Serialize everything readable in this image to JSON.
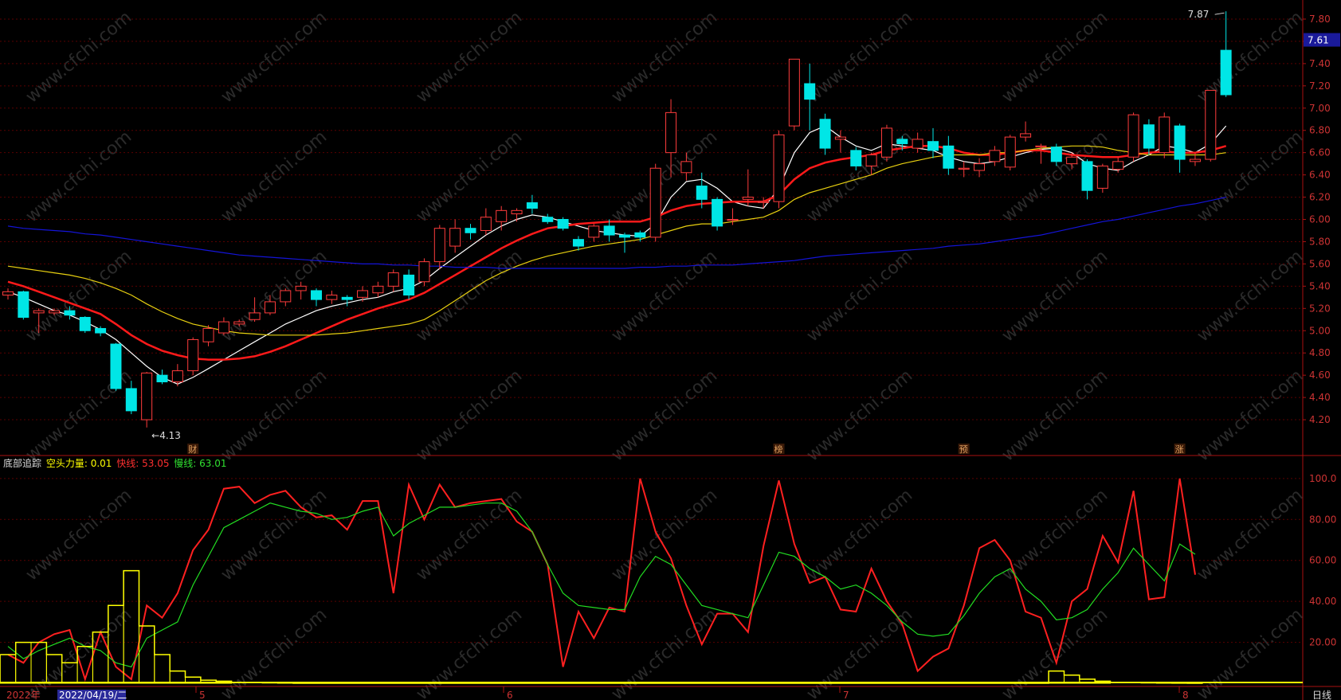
{
  "chart_data": [
    {
      "type": "candlestick",
      "ylim": [
        4.0,
        7.9
      ],
      "y_ticks": [
        "4.20",
        "4.40",
        "4.60",
        "4.80",
        "5.00",
        "5.20",
        "5.40",
        "5.60",
        "5.80",
        "6.00",
        "6.20",
        "6.40",
        "6.60",
        "6.80",
        "7.00",
        "7.20",
        "7.40",
        "7.60",
        "7.80"
      ],
      "current_price": "7.61",
      "high_label": "7.87",
      "low_label": "4.13",
      "markers": [
        "财",
        "榜",
        "预",
        "涨"
      ],
      "candles": [
        [
          5.32,
          5.35,
          5.28,
          5.38
        ],
        [
          5.35,
          5.12,
          5.1,
          5.36
        ],
        [
          5.16,
          5.18,
          4.98,
          5.2
        ],
        [
          5.16,
          5.18,
          5.14,
          5.2
        ],
        [
          5.18,
          5.14,
          5.1,
          5.22
        ],
        [
          5.12,
          5.0,
          4.98,
          5.13
        ],
        [
          5.02,
          4.98,
          4.95,
          5.04
        ],
        [
          4.88,
          4.48,
          4.46,
          4.89
        ],
        [
          4.48,
          4.28,
          4.25,
          4.55
        ],
        [
          4.2,
          4.62,
          4.13,
          4.63
        ],
        [
          4.6,
          4.54,
          4.52,
          4.65
        ],
        [
          4.54,
          4.64,
          4.5,
          4.7
        ],
        [
          4.64,
          4.92,
          4.6,
          4.94
        ],
        [
          4.9,
          5.02,
          4.86,
          5.05
        ],
        [
          4.98,
          5.08,
          4.96,
          5.12
        ],
        [
          5.06,
          5.08,
          5.04,
          5.1
        ],
        [
          5.1,
          5.16,
          5.08,
          5.3
        ],
        [
          5.16,
          5.26,
          5.14,
          5.32
        ],
        [
          5.26,
          5.36,
          5.22,
          5.38
        ],
        [
          5.36,
          5.4,
          5.28,
          5.44
        ],
        [
          5.36,
          5.28,
          5.22,
          5.38
        ],
        [
          5.28,
          5.32,
          5.24,
          5.36
        ],
        [
          5.3,
          5.28,
          5.22,
          5.32
        ],
        [
          5.3,
          5.36,
          5.26,
          5.4
        ],
        [
          5.34,
          5.4,
          5.3,
          5.44
        ],
        [
          5.4,
          5.52,
          5.35,
          5.55
        ],
        [
          5.5,
          5.32,
          5.28,
          5.55
        ],
        [
          5.44,
          5.62,
          5.4,
          5.65
        ],
        [
          5.62,
          5.92,
          5.55,
          5.95
        ],
        [
          5.76,
          5.92,
          5.7,
          6.0
        ],
        [
          5.92,
          5.88,
          5.82,
          5.96
        ],
        [
          5.9,
          6.02,
          5.86,
          6.1
        ],
        [
          5.98,
          6.08,
          5.9,
          6.12
        ],
        [
          6.05,
          6.08,
          5.98,
          6.1
        ],
        [
          6.15,
          6.1,
          6.05,
          6.22
        ],
        [
          6.02,
          5.98,
          5.96,
          6.05
        ],
        [
          6.0,
          5.92,
          5.9,
          6.02
        ],
        [
          5.82,
          5.76,
          5.72,
          5.85
        ],
        [
          5.84,
          5.94,
          5.8,
          5.96
        ],
        [
          5.94,
          5.86,
          5.8,
          6.0
        ],
        [
          5.86,
          5.84,
          5.7,
          5.88
        ],
        [
          5.88,
          5.84,
          5.8,
          5.9
        ],
        [
          5.84,
          6.46,
          5.8,
          6.5
        ],
        [
          6.6,
          6.96,
          6.38,
          7.08
        ],
        [
          6.42,
          6.52,
          6.35,
          6.6
        ],
        [
          6.3,
          6.18,
          6.1,
          6.42
        ],
        [
          6.18,
          5.94,
          5.9,
          6.2
        ],
        [
          6.0,
          6.0,
          5.95,
          6.1
        ],
        [
          6.18,
          6.2,
          6.12,
          6.45
        ],
        [
          6.16,
          6.16,
          6.1,
          6.2
        ],
        [
          6.16,
          6.76,
          6.1,
          6.8
        ],
        [
          6.84,
          7.44,
          6.8,
          7.44
        ],
        [
          7.22,
          7.08,
          6.8,
          7.4
        ],
        [
          6.9,
          6.64,
          6.58,
          6.95
        ],
        [
          6.72,
          6.74,
          6.6,
          6.8
        ],
        [
          6.62,
          6.48,
          6.44,
          6.65
        ],
        [
          6.48,
          6.58,
          6.4,
          6.6
        ],
        [
          6.56,
          6.82,
          6.52,
          6.85
        ],
        [
          6.72,
          6.68,
          6.62,
          6.75
        ],
        [
          6.64,
          6.72,
          6.6,
          6.78
        ],
        [
          6.7,
          6.62,
          6.55,
          6.82
        ],
        [
          6.66,
          6.46,
          6.4,
          6.75
        ],
        [
          6.46,
          6.46,
          6.38,
          6.52
        ],
        [
          6.44,
          6.5,
          6.38,
          6.55
        ],
        [
          6.52,
          6.62,
          6.48,
          6.66
        ],
        [
          6.47,
          6.74,
          6.44,
          6.76
        ],
        [
          6.74,
          6.77,
          6.7,
          6.88
        ],
        [
          6.66,
          6.66,
          6.5,
          6.68
        ],
        [
          6.65,
          6.52,
          6.48,
          6.68
        ],
        [
          6.5,
          6.56,
          6.45,
          6.6
        ],
        [
          6.52,
          6.26,
          6.18,
          6.54
        ],
        [
          6.28,
          6.48,
          6.24,
          6.5
        ],
        [
          6.45,
          6.52,
          6.42,
          6.56
        ],
        [
          6.56,
          6.94,
          6.52,
          6.96
        ],
        [
          6.85,
          6.64,
          6.58,
          6.9
        ],
        [
          6.6,
          6.92,
          6.55,
          6.96
        ],
        [
          6.84,
          6.54,
          6.42,
          6.86
        ],
        [
          6.52,
          6.54,
          6.48,
          6.6
        ],
        [
          6.54,
          7.16,
          6.52,
          7.16
        ],
        [
          7.52,
          7.12,
          7.1,
          7.87
        ]
      ],
      "ma_series": [
        {
          "color": "#ffffff",
          "values": [
            5.35,
            5.3,
            5.24,
            5.18,
            5.14,
            5.08,
            5.01,
            4.92,
            4.8,
            4.68,
            4.58,
            4.52,
            4.58,
            4.66,
            4.74,
            4.82,
            4.9,
            4.98,
            5.06,
            5.12,
            5.18,
            5.22,
            5.25,
            5.28,
            5.3,
            5.35,
            5.38,
            5.45,
            5.56,
            5.66,
            5.76,
            5.86,
            5.94,
            6.0,
            6.04,
            6.02,
            5.98,
            5.94,
            5.9,
            5.88,
            5.86,
            5.85,
            5.96,
            6.2,
            6.34,
            6.36,
            6.28,
            6.16,
            6.12,
            6.1,
            6.28,
            6.6,
            6.78,
            6.84,
            6.74,
            6.66,
            6.62,
            6.68,
            6.66,
            6.64,
            6.62,
            6.56,
            6.52,
            6.5,
            6.52,
            6.56,
            6.6,
            6.63,
            6.64,
            6.6,
            6.5,
            6.46,
            6.44,
            6.52,
            6.58,
            6.66,
            6.64,
            6.6,
            6.68,
            6.84
          ]
        },
        {
          "color": "#ff1a1a",
          "values": [
            5.44,
            5.4,
            5.35,
            5.3,
            5.25,
            5.2,
            5.15,
            5.06,
            4.96,
            4.88,
            4.82,
            4.78,
            4.75,
            4.74,
            4.74,
            4.75,
            4.77,
            4.81,
            4.86,
            4.92,
            4.98,
            5.04,
            5.1,
            5.15,
            5.2,
            5.24,
            5.28,
            5.34,
            5.42,
            5.5,
            5.58,
            5.66,
            5.74,
            5.81,
            5.87,
            5.92,
            5.94,
            5.96,
            5.97,
            5.98,
            5.98,
            5.98,
            6.02,
            6.08,
            6.12,
            6.14,
            6.15,
            6.16,
            6.16,
            6.16,
            6.22,
            6.36,
            6.46,
            6.51,
            6.54,
            6.56,
            6.58,
            6.62,
            6.64,
            6.66,
            6.66,
            6.64,
            6.6,
            6.58,
            6.58,
            6.6,
            6.62,
            6.62,
            6.6,
            6.58,
            6.57,
            6.56,
            6.56,
            6.58,
            6.6,
            6.61,
            6.6,
            6.6,
            6.62,
            6.66
          ]
        },
        {
          "color": "#e8d010",
          "values": [
            5.58,
            5.56,
            5.54,
            5.52,
            5.5,
            5.47,
            5.43,
            5.38,
            5.32,
            5.24,
            5.17,
            5.11,
            5.06,
            5.03,
            5.0,
            4.98,
            4.97,
            4.96,
            4.96,
            4.96,
            4.96,
            4.97,
            4.98,
            5.0,
            5.02,
            5.04,
            5.06,
            5.1,
            5.18,
            5.27,
            5.36,
            5.45,
            5.52,
            5.58,
            5.63,
            5.67,
            5.7,
            5.73,
            5.76,
            5.78,
            5.8,
            5.82,
            5.86,
            5.9,
            5.94,
            5.96,
            5.96,
            5.98,
            6.0,
            6.02,
            6.08,
            6.18,
            6.24,
            6.28,
            6.32,
            6.36,
            6.4,
            6.46,
            6.5,
            6.53,
            6.56,
            6.58,
            6.58,
            6.58,
            6.6,
            6.6,
            6.62,
            6.64,
            6.65,
            6.66,
            6.66,
            6.65,
            6.62,
            6.6,
            6.58,
            6.58,
            6.58,
            6.58,
            6.58,
            6.6
          ]
        },
        {
          "color": "#1414d8",
          "values": [
            5.94,
            5.92,
            5.91,
            5.9,
            5.89,
            5.87,
            5.86,
            5.84,
            5.82,
            5.8,
            5.78,
            5.76,
            5.74,
            5.72,
            5.7,
            5.68,
            5.67,
            5.66,
            5.65,
            5.64,
            5.63,
            5.62,
            5.61,
            5.6,
            5.6,
            5.59,
            5.59,
            5.58,
            5.58,
            5.57,
            5.57,
            5.57,
            5.56,
            5.56,
            5.56,
            5.56,
            5.56,
            5.56,
            5.56,
            5.56,
            5.56,
            5.57,
            5.57,
            5.58,
            5.58,
            5.59,
            5.59,
            5.59,
            5.6,
            5.61,
            5.62,
            5.63,
            5.65,
            5.67,
            5.68,
            5.69,
            5.7,
            5.71,
            5.72,
            5.73,
            5.74,
            5.76,
            5.77,
            5.78,
            5.8,
            5.82,
            5.84,
            5.86,
            5.89,
            5.92,
            5.95,
            5.98,
            6.0,
            6.03,
            6.06,
            6.09,
            6.12,
            6.14,
            6.17,
            6.2
          ]
        }
      ]
    },
    {
      "type": "line",
      "title": "底部追踪",
      "legend": [
        {
          "label": "空头力量: 0.01",
          "color": "#ffff00"
        },
        {
          "label": "快线: 53.05",
          "color": "#ff3030"
        },
        {
          "label": "慢线: 63.01",
          "color": "#30e030"
        }
      ],
      "ylim": [
        0,
        105
      ],
      "y_ticks": [
        "20.00",
        "40.00",
        "60.00",
        "80.00",
        "100.0"
      ],
      "series": [
        {
          "color": "#ff2020",
          "values": [
            14,
            10,
            20,
            24,
            26,
            2,
            25,
            8,
            2,
            38,
            32,
            44,
            65,
            75,
            95,
            96,
            88,
            92,
            94,
            86,
            81,
            82,
            75,
            89,
            89,
            44,
            97,
            80,
            97,
            86,
            88,
            89,
            90,
            79,
            74,
            58,
            8,
            35,
            22,
            37,
            35,
            100,
            74,
            61,
            38,
            19,
            34,
            34,
            25,
            67,
            99,
            68,
            49,
            52,
            36,
            35,
            56,
            40,
            29,
            6,
            13,
            17,
            38,
            66,
            70,
            60,
            35,
            32,
            10,
            40,
            46,
            72,
            59,
            94,
            41,
            42,
            100,
            53
          ]
        },
        {
          "color": "#22dd22",
          "values": [
            18,
            12,
            16,
            19,
            22,
            18,
            16,
            10,
            8,
            22,
            26,
            30,
            48,
            62,
            76,
            80,
            84,
            88,
            86,
            84,
            83,
            80,
            81,
            84,
            86,
            72,
            78,
            82,
            86,
            86,
            87,
            88,
            88,
            84,
            74,
            58,
            44,
            38,
            37,
            36,
            36,
            52,
            62,
            58,
            48,
            38,
            36,
            34,
            32,
            48,
            64,
            62,
            56,
            52,
            46,
            48,
            44,
            38,
            30,
            24,
            23,
            24,
            33,
            44,
            52,
            56,
            46,
            40,
            31,
            32,
            36,
            46,
            54,
            66,
            58,
            50,
            68,
            63
          ]
        },
        {
          "color": "#ffff00",
          "type": "step",
          "values": [
            14,
            20,
            20,
            14,
            10,
            18,
            25,
            38,
            55,
            28,
            14,
            6,
            3,
            1.5,
            1,
            0.5,
            0.3,
            0.2,
            0.1,
            0,
            0,
            0,
            0,
            0,
            0,
            0,
            0,
            0,
            0,
            0,
            0,
            0,
            0,
            0,
            0,
            0,
            0,
            0,
            0,
            0,
            0,
            0,
            0,
            0,
            0,
            0,
            0,
            0,
            0,
            0,
            0,
            0,
            0,
            0,
            0,
            0,
            0,
            0,
            0,
            0,
            0,
            0,
            0,
            0,
            0,
            0,
            0,
            0,
            6,
            4,
            2,
            1,
            0.5,
            0.3,
            0.2,
            0.1,
            0.05,
            0.01
          ]
        }
      ]
    }
  ],
  "x_axis": {
    "labels": [
      "2022年",
      "2022/04/19/二",
      "5",
      "6",
      "7",
      "8"
    ],
    "period": "日线"
  },
  "watermark": "www.cfchi.com"
}
